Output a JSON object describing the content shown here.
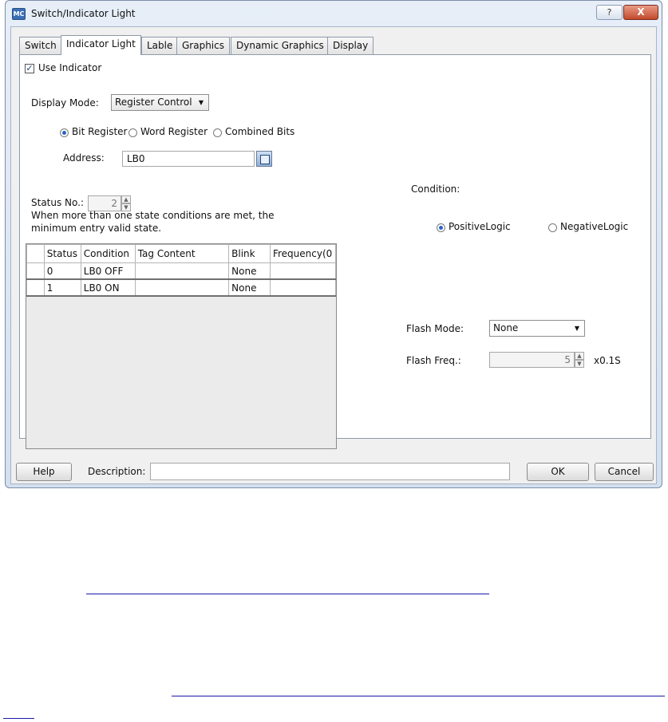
{
  "window": {
    "app_icon_text": "MC",
    "title": "Switch/Indicator Light",
    "help_label": "?",
    "close_label": "X"
  },
  "tabs": [
    "Switch",
    "Indicator Light",
    "Lable",
    "Graphics",
    "Dynamic Graphics",
    "Display"
  ],
  "use_indicator": {
    "label": "Use Indicator",
    "checked": true,
    "mark": "✓"
  },
  "display_mode": {
    "label": "Display Mode:",
    "value": "Register Control",
    "arrow": "▼"
  },
  "register_type": {
    "options": [
      "Bit Register",
      "Word Register",
      "Combined Bits"
    ],
    "selected": "Bit Register"
  },
  "address": {
    "label": "Address:",
    "value": "LB0",
    "button_icon": "address-keypad-icon"
  },
  "status_no": {
    "label": "Status No.:",
    "value": "2",
    "up": "▲",
    "down": "▼"
  },
  "note": {
    "line1": "When more than one state conditions are met, the",
    "line2": "minimum entry valid state."
  },
  "status_table": {
    "columns": [
      "",
      "Status",
      "Condition",
      "Tag Content",
      "Blink",
      "Frequency(0"
    ],
    "rows": [
      [
        "",
        "0",
        "LB0 OFF",
        "",
        "None",
        ""
      ],
      [
        "",
        "1",
        "LB0 ON",
        "",
        "None",
        ""
      ]
    ]
  },
  "condition": {
    "label": "Condition:",
    "options": [
      "PositiveLogic",
      "NegativeLogic"
    ],
    "selected": "PositiveLogic"
  },
  "flash_mode": {
    "label": "Flash Mode:",
    "value": "None",
    "arrow": "▼"
  },
  "flash_freq": {
    "label": "Flash Freq.:",
    "value": "5",
    "unit": "x0.1S",
    "up": "▲",
    "down": "▼"
  },
  "footer": {
    "help_label": "Help",
    "description_label": "Description:",
    "description_value": "",
    "ok_label": "OK",
    "cancel_label": "Cancel"
  },
  "colors": {
    "accent": "#2a63c7",
    "link": "#1a1aa8",
    "close": "#c24a2c"
  }
}
